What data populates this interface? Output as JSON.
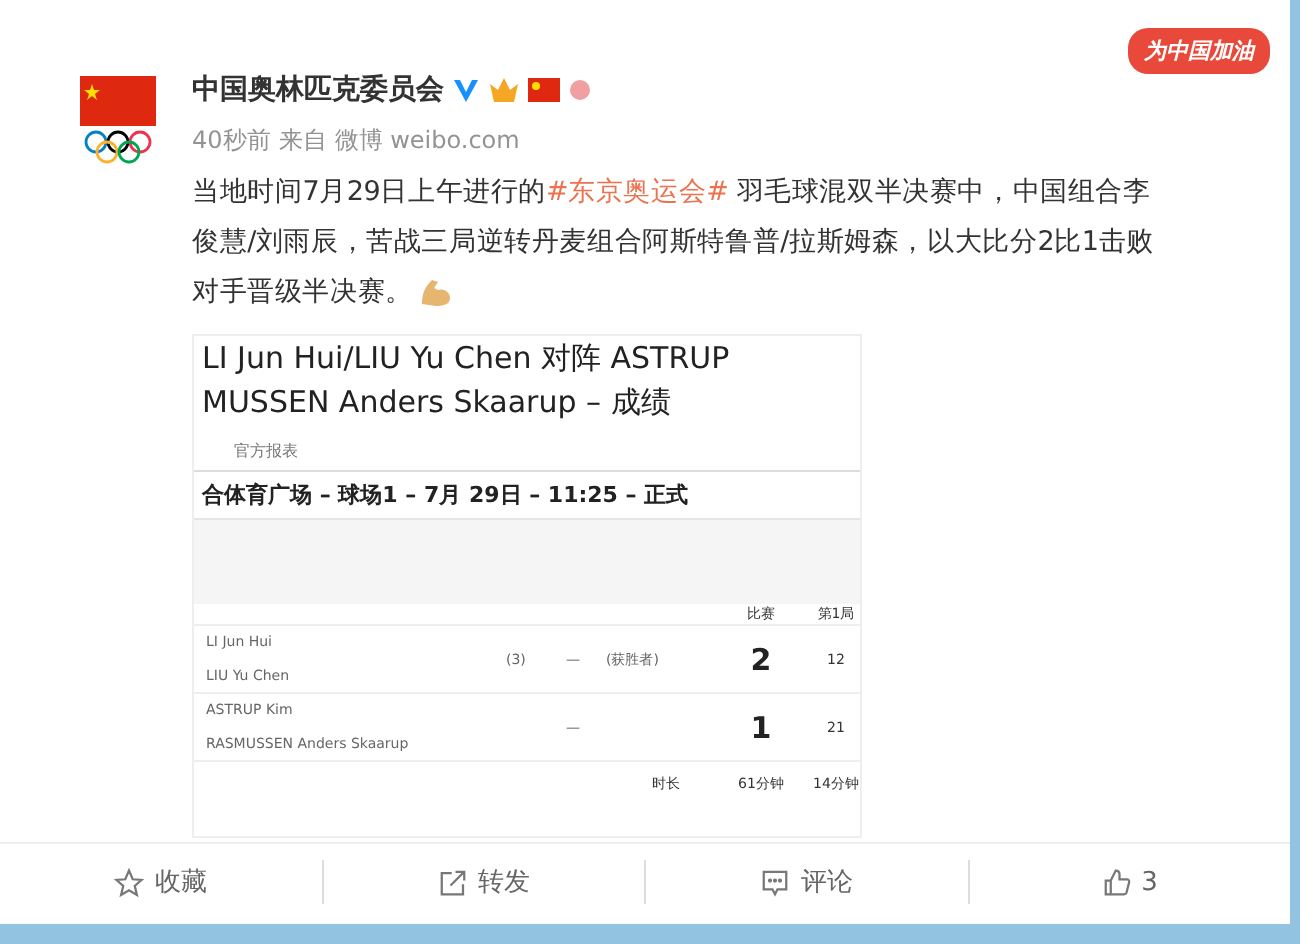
{
  "post": {
    "author": "中国奥林匹克委员会",
    "sticker": "为中国加油",
    "time": "40秒前",
    "source_prefix": "来自",
    "source": "微博 weibo.com",
    "body": [
      {
        "kind": "text",
        "text": "当地时间7月29日上午进行的"
      },
      {
        "kind": "hashtag",
        "text": "#东京奥运会#"
      },
      {
        "kind": "text",
        "text": " 羽毛球混双半决赛中，中国组合李俊慧/刘雨辰，苦战三局逆转丹麦组合阿斯特鲁普/拉斯姆森，以大比分2比1击败对手晋级半决赛。"
      }
    ]
  },
  "image": {
    "title_lines": [
      "LI Jun Hui/LIU Yu Chen 对阵 ASTRUP",
      "MUSSEN Anders Skaarup – 成绩"
    ],
    "report_label": "官方报表",
    "venue": "合体育广场 – 球场1 – 7月 29日 – 11:25 – 正式",
    "columns": [
      "比赛",
      "第1局"
    ],
    "teams": [
      {
        "players": [
          "LI Jun Hui",
          "LIU Yu Chen"
        ],
        "seed": "(3)",
        "dash": "—",
        "note": "(获胜者)",
        "match": "2",
        "game_1": "12"
      },
      {
        "players": [
          "ASTRUP Kim",
          "RASMUSSEN Anders Skaarup"
        ],
        "dash": "—",
        "match": "1",
        "game_1": "21"
      }
    ],
    "duration": {
      "label": "时长",
      "match": "61分钟",
      "game_1": "14分钟"
    }
  },
  "actions": [
    {
      "kind": "star",
      "label": "收藏"
    },
    {
      "kind": "share",
      "label": "转发"
    },
    {
      "kind": "comment",
      "label": "评论"
    },
    {
      "kind": "like",
      "label": "3"
    }
  ]
}
